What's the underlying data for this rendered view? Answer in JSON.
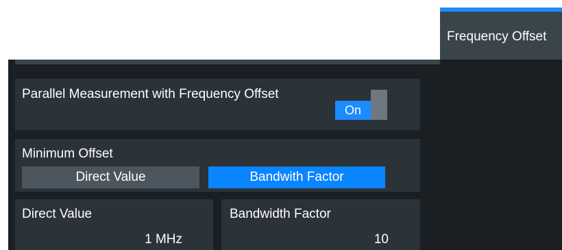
{
  "tab": {
    "label": "Frequency Offset"
  },
  "parallel": {
    "label": "Parallel Measurement with Frequency Offset",
    "toggle_state": "On"
  },
  "minimum_offset": {
    "label": "Minimum Offset",
    "options": [
      "Direct Value",
      "Bandwith Factor"
    ],
    "selected": "Bandwith Factor"
  },
  "direct_value": {
    "label": "Direct Value",
    "value": "1 MHz"
  },
  "bandwidth_factor": {
    "label": "Bandwidth Factor",
    "value": "10"
  },
  "colors": {
    "accent": "#1a8cff",
    "panel": "#1a1f24",
    "group": "#2b3238",
    "tab": "#3a444b",
    "inactive_button": "#4b565e"
  }
}
